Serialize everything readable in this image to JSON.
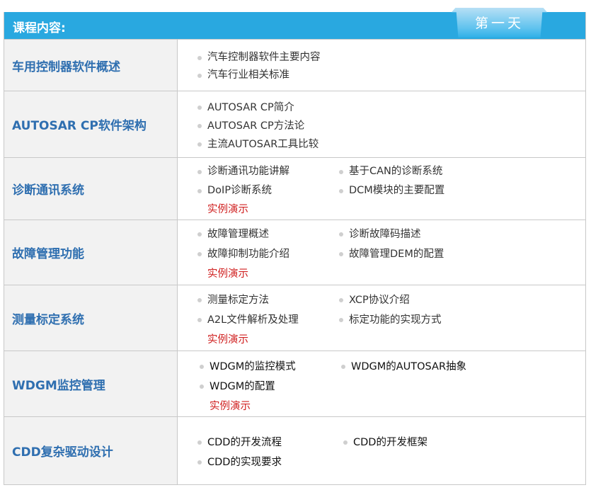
{
  "header": {
    "title": "课程内容:",
    "day_tab": "第一天"
  },
  "rows": [
    {
      "title": "车用控制器软件概述",
      "items": [
        "汽车控制器软件主要内容",
        "汽车行业相关标准"
      ],
      "columns": 1
    },
    {
      "title": "AUTOSAR CP软件架构",
      "items": [
        "AUTOSAR CP简介",
        "AUTOSAR CP方法论",
        "主流AUTOSAR工具比较"
      ],
      "columns": 1
    },
    {
      "title": "诊断通讯系统",
      "items": [
        "诊断通讯功能讲解",
        "基于CAN的诊断系统",
        "DoIP诊断系统",
        "DCM模块的主要配置"
      ],
      "columns": 2,
      "demo": "实例演示"
    },
    {
      "title": "故障管理功能",
      "items": [
        "故障管理概述",
        "诊断故障码描述",
        "故障抑制功能介绍",
        "故障管理DEM的配置"
      ],
      "columns": 2,
      "demo": "实例演示"
    },
    {
      "title": "测量标定系统",
      "items": [
        "测量标定方法",
        "XCP协议介绍",
        "A2L文件解析及处理",
        "标定功能的实现方式"
      ],
      "columns": 2,
      "demo": "实例演示"
    },
    {
      "title": "WDGM监控管理",
      "items": [
        "WDGM的监控模式",
        "WDGM的AUTOSAR抽象",
        "WDGM的配置"
      ],
      "columns": 2,
      "demo": "实例演示"
    },
    {
      "title": "CDD复杂驱动设计",
      "items": [
        "CDD的开发流程",
        "CDD的开发框架",
        "CDD的实现要求"
      ],
      "columns": 2
    }
  ]
}
